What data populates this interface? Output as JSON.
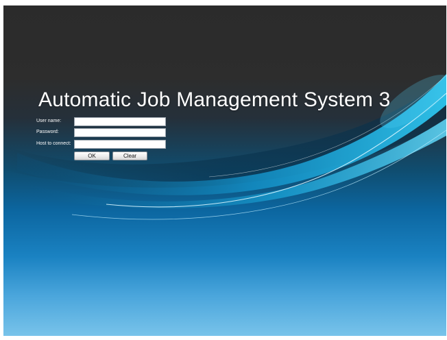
{
  "login": {
    "title": "Automatic Job Management System 3",
    "fields": {
      "username": {
        "label": "User name:",
        "value": ""
      },
      "password": {
        "label": "Password:",
        "value": ""
      },
      "host": {
        "label": "Host to connect:",
        "value": ""
      }
    },
    "buttons": {
      "ok": "OK",
      "clear": "Clear"
    }
  },
  "colors": {
    "top_background": "#2b2b2b",
    "mid_blue": "#0c66a0",
    "bottom_blue": "#78c3ea",
    "swoosh_cyan": "#1fb6e6",
    "title_text": "#ffffff"
  }
}
